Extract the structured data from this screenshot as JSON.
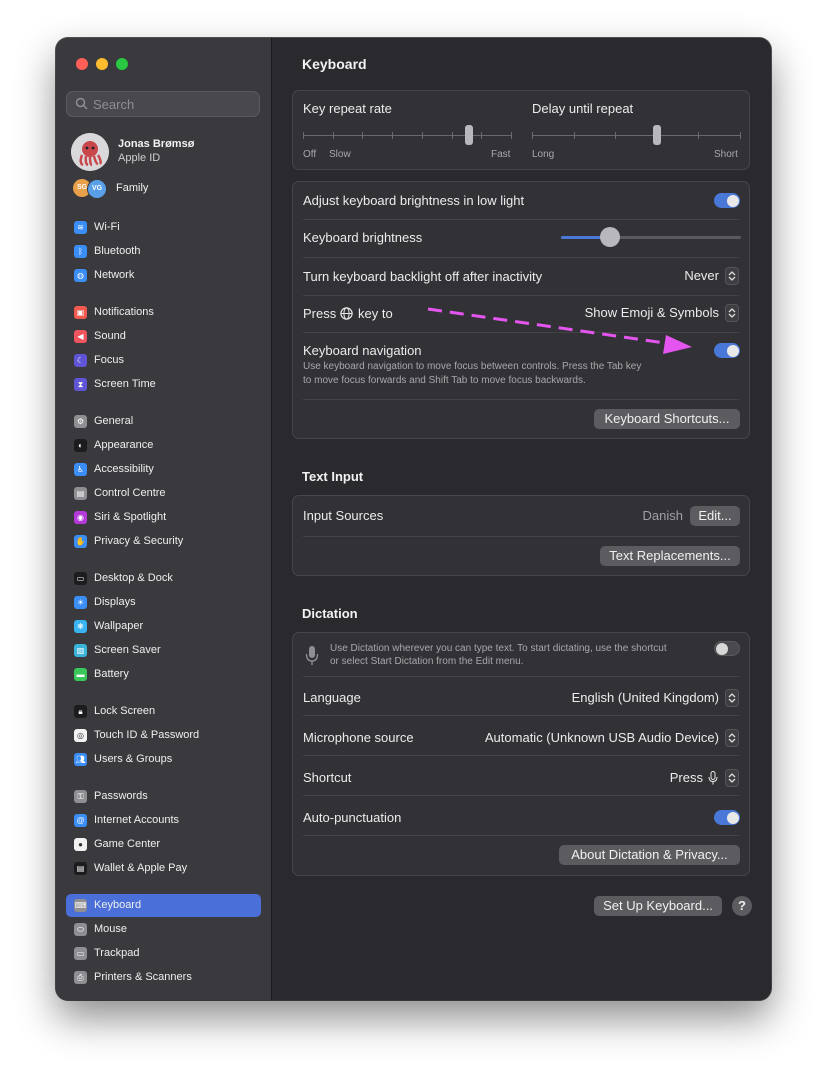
{
  "colors": {
    "accent": "#4a78d8",
    "sidebar_active": "#4a6fd8",
    "annotation_arrow": "#e455f0",
    "traffic_close": "#ff5f57",
    "traffic_min": "#febc2e",
    "traffic_max": "#28c840"
  },
  "sidebar": {
    "search_placeholder": "Search",
    "profile": {
      "name": "Jonas Brømsø",
      "subtitle": "Apple ID"
    },
    "family": {
      "label": "Family",
      "avatars": [
        "SG",
        "VG"
      ]
    },
    "items": [
      {
        "label": "Wi-Fi",
        "icon": "wifi-icon",
        "color": "#3a8ef6",
        "glyph": "≋"
      },
      {
        "label": "Bluetooth",
        "icon": "bluetooth-icon",
        "color": "#3a8ef6",
        "glyph": "ᛒ"
      },
      {
        "label": "Network",
        "icon": "globe-icon",
        "color": "#3a8ef6",
        "glyph": "◍"
      },
      {
        "label": "Notifications",
        "icon": "bell-icon",
        "color": "#f05a4f",
        "glyph": "▣"
      },
      {
        "label": "Sound",
        "icon": "speaker-icon",
        "color": "#f0545e",
        "glyph": "◀"
      },
      {
        "label": "Focus",
        "icon": "moon-icon",
        "color": "#6055d6",
        "glyph": "☾"
      },
      {
        "label": "Screen Time",
        "icon": "hourglass-icon",
        "color": "#6055d6",
        "glyph": "⧗"
      },
      {
        "label": "General",
        "icon": "gear-icon",
        "color": "#8e8e93",
        "glyph": "⚙"
      },
      {
        "label": "Appearance",
        "icon": "appearance-icon",
        "color": "#1c1c1e",
        "glyph": "◐"
      },
      {
        "label": "Accessibility",
        "icon": "accessibility-icon",
        "color": "#3a8ef6",
        "glyph": "♿"
      },
      {
        "label": "Control Centre",
        "icon": "control-centre-icon",
        "color": "#8e8e93",
        "glyph": "▤"
      },
      {
        "label": "Siri & Spotlight",
        "icon": "siri-icon",
        "color": "#b43ad8",
        "glyph": "◉"
      },
      {
        "label": "Privacy & Security",
        "icon": "hand-icon",
        "color": "#3a8ef6",
        "glyph": "✋"
      },
      {
        "label": "Desktop & Dock",
        "icon": "dock-icon",
        "color": "#1c1c1e",
        "glyph": "▭"
      },
      {
        "label": "Displays",
        "icon": "sun-icon",
        "color": "#3a8ef6",
        "glyph": "☀"
      },
      {
        "label": "Wallpaper",
        "icon": "wallpaper-icon",
        "color": "#3ab4f0",
        "glyph": "❋"
      },
      {
        "label": "Screen Saver",
        "icon": "screensaver-icon",
        "color": "#3ab4d8",
        "glyph": "▨"
      },
      {
        "label": "Battery",
        "icon": "battery-icon",
        "color": "#3ac85a",
        "glyph": "▬"
      },
      {
        "label": "Lock Screen",
        "icon": "lock-icon",
        "color": "#1c1c1e",
        "glyph": "🔒︎"
      },
      {
        "label": "Touch ID & Password",
        "icon": "fingerprint-icon",
        "color": "#f2f2f2",
        "glyph": "◎"
      },
      {
        "label": "Users & Groups",
        "icon": "users-icon",
        "color": "#3a8ef6",
        "glyph": "👥︎"
      },
      {
        "label": "Passwords",
        "icon": "key-icon",
        "color": "#8e8e93",
        "glyph": "⚿"
      },
      {
        "label": "Internet Accounts",
        "icon": "at-icon",
        "color": "#3a8ef6",
        "glyph": "@"
      },
      {
        "label": "Game Center",
        "icon": "game-center-icon",
        "color": "#f2f2f2",
        "glyph": "●"
      },
      {
        "label": "Wallet & Apple Pay",
        "icon": "wallet-icon",
        "color": "#1c1c1e",
        "glyph": "▤"
      },
      {
        "label": "Keyboard",
        "icon": "keyboard-icon",
        "color": "#8e8e93",
        "glyph": "⌨",
        "active": true
      },
      {
        "label": "Mouse",
        "icon": "mouse-icon",
        "color": "#8e8e93",
        "glyph": "⬭"
      },
      {
        "label": "Trackpad",
        "icon": "trackpad-icon",
        "color": "#8e8e93",
        "glyph": "▭"
      },
      {
        "label": "Printers & Scanners",
        "icon": "printer-icon",
        "color": "#8e8e93",
        "glyph": "⎙"
      }
    ]
  },
  "main": {
    "title": "Keyboard",
    "repeat": {
      "key_repeat_label": "Key repeat rate",
      "key_repeat_off": "Off",
      "key_repeat_slow": "Slow",
      "key_repeat_fast": "Fast",
      "key_repeat_level": 0.8,
      "delay_label": "Delay until repeat",
      "delay_long": "Long",
      "delay_short": "Short",
      "delay_level": 0.6
    },
    "settings": {
      "adjust_brightness_label": "Adjust keyboard brightness in low light",
      "adjust_brightness_on": true,
      "brightness_label": "Keyboard brightness",
      "brightness_level": 0.27,
      "backlight_off_label": "Turn keyboard backlight off after inactivity",
      "backlight_off_value": "Never",
      "press_key_prefix": "Press",
      "press_key_suffix": "key to",
      "press_key_value": "Show Emoji & Symbols",
      "keyboard_nav_label": "Keyboard navigation",
      "keyboard_nav_desc_1": "Use keyboard navigation to move focus between controls. Press the Tab key",
      "keyboard_nav_desc_2": "to move focus forwards and Shift Tab to move focus backwards.",
      "keyboard_nav_on": true,
      "shortcuts_button": "Keyboard Shortcuts..."
    },
    "text_input": {
      "title": "Text Input",
      "input_sources_label": "Input Sources",
      "input_sources_value": "Danish",
      "edit_button": "Edit...",
      "text_replacements_button": "Text Replacements..."
    },
    "dictation": {
      "title": "Dictation",
      "desc_1": "Use Dictation wherever you can type text. To start dictating, use the shortcut",
      "desc_2": "or select Start Dictation from the Edit menu.",
      "dictation_on": false,
      "language_label": "Language",
      "language_value": "English (United Kingdom)",
      "mic_label": "Microphone source",
      "mic_value": "Automatic (Unknown USB Audio Device)",
      "shortcut_label": "Shortcut",
      "shortcut_value": "Press",
      "autopunct_label": "Auto-punctuation",
      "autopunct_on": true,
      "about_button": "About Dictation & Privacy..."
    },
    "footer": {
      "setup_button": "Set Up Keyboard...",
      "help_button": "?"
    }
  }
}
